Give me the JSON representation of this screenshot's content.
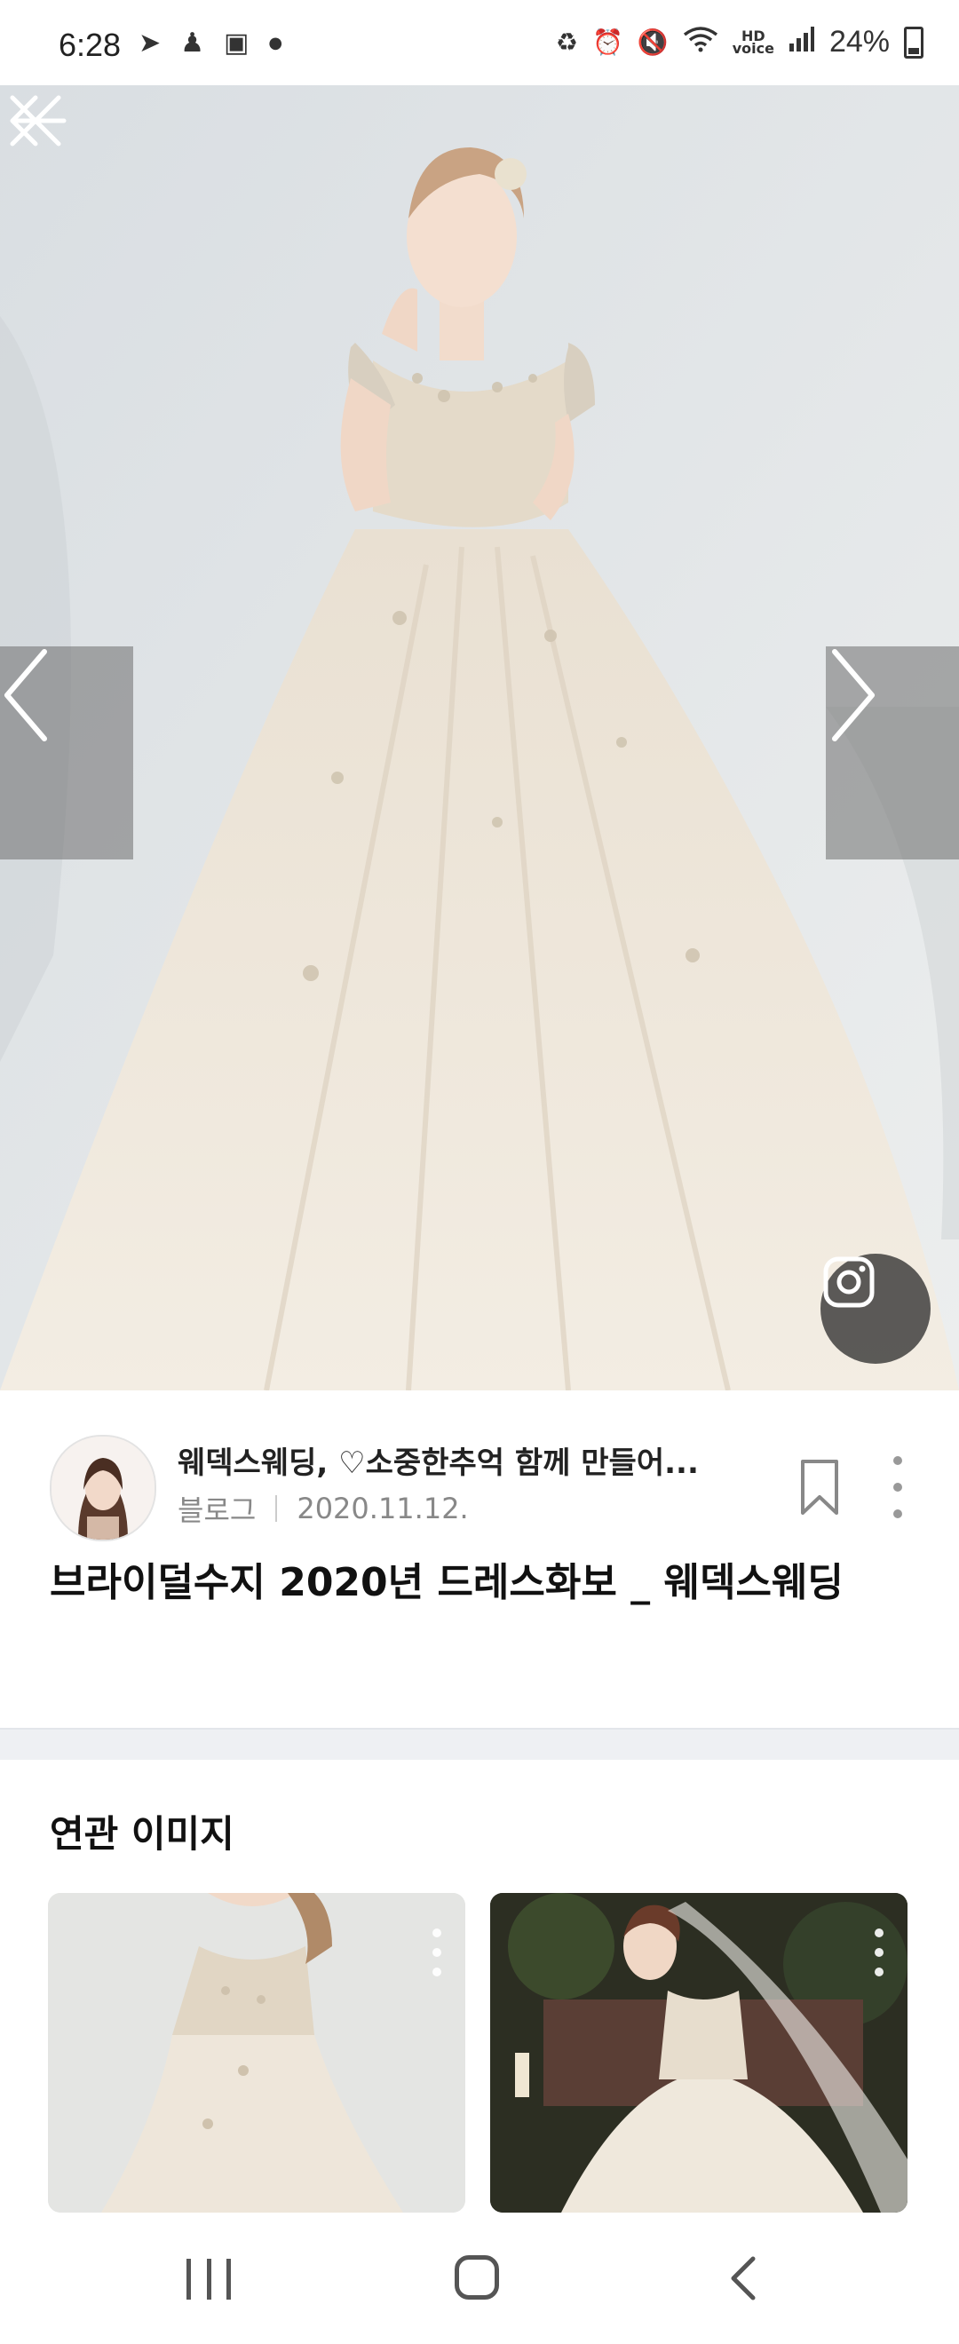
{
  "status": {
    "time": "6:28",
    "left_icons": [
      "telegram-icon",
      "person-icon",
      "gallery-icon",
      "dot-icon"
    ],
    "right_icons": [
      "recycle-icon",
      "alarm-icon",
      "mute-icon",
      "wifi-icon",
      "hd-voice-icon",
      "signal-icon"
    ],
    "battery": "24%"
  },
  "hero": {
    "colors": {
      "background": "#e3e6e8",
      "dress": "#efe7da"
    }
  },
  "info": {
    "source_name": "웨덱스웨딩, ♡소중한추억 함께 만들어...",
    "source_type": "블로그",
    "date": "2020.11.12.",
    "title": "브라이덜수지 2020년 드레스화보 _ 웨덱스웨딩"
  },
  "related": {
    "title": "연관 이미지"
  }
}
